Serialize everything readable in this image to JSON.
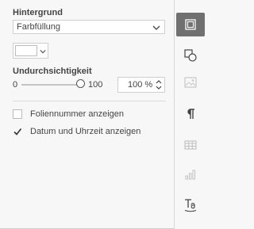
{
  "background": {
    "title": "Hintergrund",
    "fill_type": "Farbfüllung",
    "fill_color": "#ffffff"
  },
  "opacity": {
    "title": "Undurchsichtigkeit",
    "min_label": "0",
    "max_label": "100",
    "value": 100,
    "value_text": "100 %"
  },
  "options": {
    "slide_number": {
      "label": "Foliennummer anzeigen",
      "checked": false
    },
    "date_time": {
      "label": "Datum und Uhrzeit anzeigen",
      "checked": true
    }
  },
  "rail": {
    "items": [
      {
        "icon": "slide-settings-icon",
        "active": true
      },
      {
        "icon": "shape-settings-icon",
        "active": false
      },
      {
        "icon": "image-settings-icon",
        "active": false,
        "disabled": true
      },
      {
        "icon": "paragraph-settings-icon",
        "active": false
      },
      {
        "icon": "table-settings-icon",
        "active": false,
        "disabled": true
      },
      {
        "icon": "chart-settings-icon",
        "active": false,
        "disabled": true
      },
      {
        "icon": "text-art-settings-icon",
        "active": false
      }
    ]
  },
  "colors": {
    "active_tab": "#707070",
    "text": "#444444",
    "panel_bg": "#f7f7f7"
  }
}
